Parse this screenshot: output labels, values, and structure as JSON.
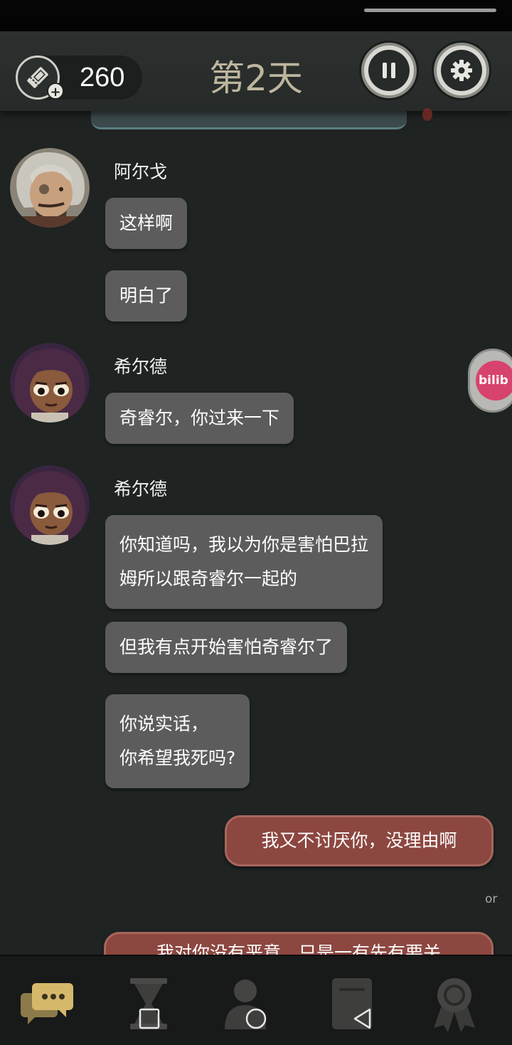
{
  "header": {
    "tickets": "260",
    "day": "第2天"
  },
  "messages": [
    {
      "speaker": "阿尔戈",
      "lines": [
        "这样啊"
      ]
    },
    {
      "lines": [
        "明白了"
      ]
    },
    {
      "speaker": "希尔德",
      "lines": [
        "奇睿尔，你过来一下"
      ]
    },
    {
      "speaker": "希尔德",
      "lines": [
        "你知道吗，我以为你是害怕巴拉",
        "姆所以跟奇睿尔一起的"
      ]
    },
    {
      "lines": [
        "但我有点开始害怕奇睿尔了"
      ]
    },
    {
      "lines": [
        "你说实话，",
        "你希望我死吗?"
      ]
    }
  ],
  "replies": {
    "option1": "我又不讨厌你，没理由啊",
    "separator": "or",
    "option2": "我对你没有恶意，只是一有先有要关"
  },
  "floating_badge": "bilib",
  "nav": [
    "chat-icon",
    "hourglass-icon",
    "person-icon",
    "document-icon",
    "medal-icon"
  ],
  "colors": {
    "background": "#1f2322",
    "bubble": "#5b5c5b",
    "reply_bubble": "#8c4740",
    "day_title": "#bdb69e"
  }
}
